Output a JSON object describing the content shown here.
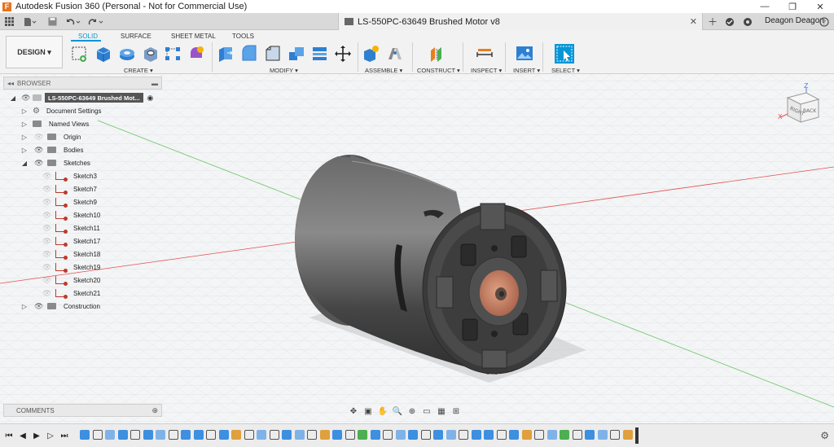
{
  "app": {
    "title": "Autodesk Fusion 360 (Personal - Not for Commercial Use)",
    "logo_letter": "F",
    "win_min": "—",
    "win_max": "❐",
    "win_close": "✕"
  },
  "doc": {
    "tab_title": "LS-550PC-63649 Brushed Motor v8",
    "close": "✕"
  },
  "user": {
    "name": "Deagon Deagon"
  },
  "toolbar": {
    "workspace": "DESIGN ▾",
    "tabs": [
      "SOLID",
      "SURFACE",
      "SHEET METAL",
      "TOOLS"
    ],
    "groups": [
      "CREATE ▾",
      "MODIFY ▾",
      "ASSEMBLE ▾",
      "CONSTRUCT ▾",
      "INSPECT ▾",
      "INSERT ▾",
      "SELECT ▾"
    ]
  },
  "browser": {
    "header": "BROWSER",
    "collapse": "◂◂",
    "minimize": "▬",
    "root": "LS-550PC-63649 Brushed Mot...",
    "items": [
      {
        "label": "Document Settings"
      },
      {
        "label": "Named Views"
      },
      {
        "label": "Origin"
      },
      {
        "label": "Bodies"
      },
      {
        "label": "Sketches"
      },
      {
        "label": "Sketch3"
      },
      {
        "label": "Sketch7"
      },
      {
        "label": "Sketch9"
      },
      {
        "label": "Sketch10"
      },
      {
        "label": "Sketch11"
      },
      {
        "label": "Sketch17"
      },
      {
        "label": "Sketch18"
      },
      {
        "label": "Sketch19"
      },
      {
        "label": "Sketch20"
      },
      {
        "label": "Sketch21"
      },
      {
        "label": "Construction"
      }
    ]
  },
  "comments": {
    "label": "COMMENTS",
    "plus": "⊕"
  },
  "viewcube": {
    "face_right": "BACK",
    "face_left": "RIGHT",
    "axis_z": "Z",
    "axis_x": "X"
  },
  "colors": {
    "accent": "#0696d7",
    "motor_body": "#4a4a4a",
    "endcap": "#3b3b3b",
    "copper": "#c87c5e",
    "red_axis": "#e05050",
    "green_axis": "#6bc46b"
  }
}
